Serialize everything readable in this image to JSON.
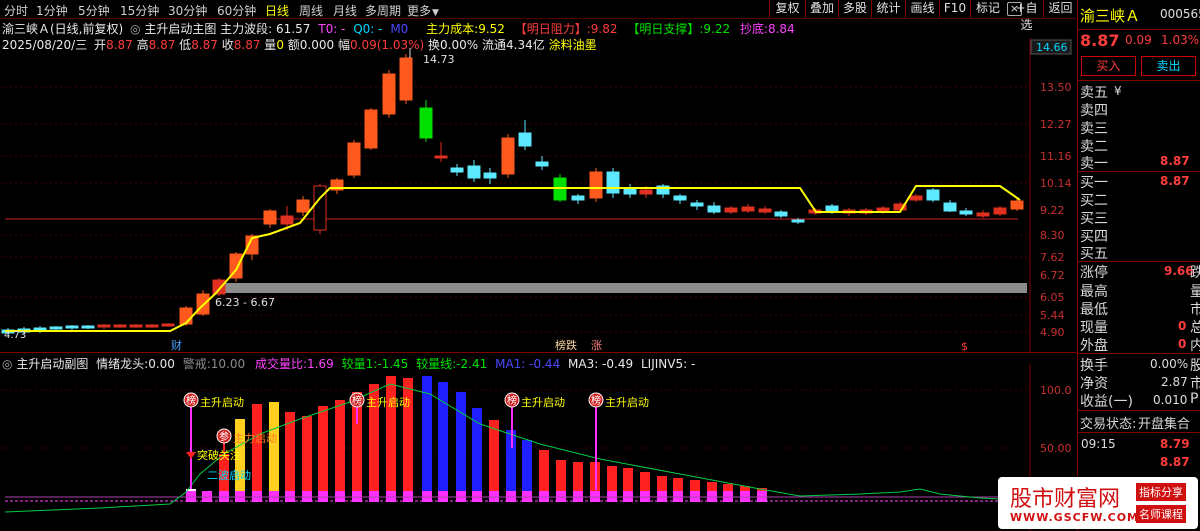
{
  "toolbar": {
    "timeframes": [
      "分时",
      "1分钟",
      "5分钟",
      "15分钟",
      "30分钟",
      "60分钟",
      "日线",
      "周线",
      "月线",
      "多周期",
      "更多"
    ],
    "active_timeframe": "日线",
    "right_buttons": [
      "复权",
      "叠加",
      "多股",
      "统计",
      "画线",
      "F10",
      "标记",
      "+自选",
      "返回"
    ]
  },
  "main": {
    "title": "渝三峡Ａ(日线,前复权)",
    "indicator": "主升启动主图",
    "wave_label": "主力波段:",
    "wave_value": "61.57",
    "t0": "T0: -",
    "q0": "Q0: -",
    "m0": "M0",
    "cost_label": "主力成本:",
    "cost_value": "9.52",
    "resist_label": "【明日阻力】:",
    "resist_value": "9.82",
    "support_label": "【明日支撑】:",
    "support_value": "9.22",
    "bottom_label": "抄底:",
    "bottom_value": "8.84",
    "date": "2025/08/20/三",
    "open_label": "开",
    "open": "8.87",
    "high_label": "高",
    "high": "8.87",
    "low_label": "低",
    "low": "8.87",
    "close_label": "收",
    "close": "8.87",
    "vol_label": "量",
    "vol": "0",
    "amount_label": "额",
    "amount": "0.000",
    "amp_label": "幅",
    "amp": "0.09(1.03%)",
    "turnover_label": "换",
    "turnover": "0.00%",
    "float_label": "流通",
    "float": "4.34亿",
    "sector": "涂料油墨",
    "price_axis": [
      "14.66",
      "13.50",
      "12.27",
      "11.16",
      "10.14",
      "9.22",
      "8.30",
      "7.62",
      "6.72",
      "6.05",
      "5.44",
      "4.90"
    ],
    "high_mark": "14.73",
    "low_mark": "4.73",
    "range_label": "6.23 - 6.67",
    "marker_cai": "财",
    "marker_bang": "榜跌",
    "marker_zhang": "涨",
    "marker_s": "$"
  },
  "sub": {
    "indicator": "主升启动副图",
    "emo_label": "情绪龙头:",
    "emo_value": "0.00",
    "alert_label": "警戒:",
    "alert_value": "10.00",
    "volratio_label": "成交量比:",
    "volratio_value": "1.69",
    "v1_label": "较量1:",
    "v1_value": "-1.45",
    "vline_label": "较量线:",
    "vline_value": "-2.41",
    "ma1": "MA1: -0.44",
    "ma3": "MA3: -0.49",
    "lijin": "LIJINV5: -",
    "axis": [
      "100.0",
      "50.00"
    ],
    "sig_main": "主升启动",
    "sig_bang": "榜",
    "sig_can": "参",
    "sig_break": "突破关注",
    "sig_second": "二波启动"
  },
  "quote": {
    "name": "渝三峡Ａ",
    "code": "000565",
    "price": "8.87",
    "change": "0.09",
    "pct": "1.03%",
    "buy_btn": "买入",
    "sell_btn": "卖出",
    "sell_levels": [
      {
        "label": "卖五",
        "value": "¥"
      },
      {
        "label": "卖四",
        "value": ""
      },
      {
        "label": "卖三",
        "value": ""
      },
      {
        "label": "卖二",
        "value": ""
      },
      {
        "label": "卖一",
        "value": "8.87"
      }
    ],
    "buy_levels": [
      {
        "label": "买一",
        "value": "8.87"
      },
      {
        "label": "买二",
        "value": ""
      },
      {
        "label": "买三",
        "value": ""
      },
      {
        "label": "买四",
        "value": ""
      },
      {
        "label": "买五",
        "value": ""
      }
    ],
    "stats": [
      {
        "label": "涨停",
        "value": "9.66",
        "tail": "跌"
      },
      {
        "label": "最高",
        "value": "",
        "tail": "量"
      },
      {
        "label": "最低",
        "value": "",
        "tail": "市"
      },
      {
        "label": "现量",
        "value": "0",
        "tail": "总"
      },
      {
        "label": "外盘",
        "value": "0",
        "tail": "内"
      }
    ],
    "stats2": [
      {
        "label": "换手",
        "value": "0.00%",
        "tail": "股"
      },
      {
        "label": "净资",
        "value": "2.87",
        "tail": "市"
      },
      {
        "label": "收益(一)",
        "value": "0.010",
        "tail": "P"
      }
    ],
    "trade_state_label": "交易状态:",
    "trade_state": "开盘集合",
    "ticks": [
      {
        "time": "09:15",
        "price": "8.79"
      },
      {
        "time": "",
        "price": "8.87"
      }
    ]
  },
  "watermark": {
    "brand": "股市财富网",
    "url": "WWW.GSCFW.COM",
    "tag1": "指标分享",
    "tag2": "名师课程"
  }
}
